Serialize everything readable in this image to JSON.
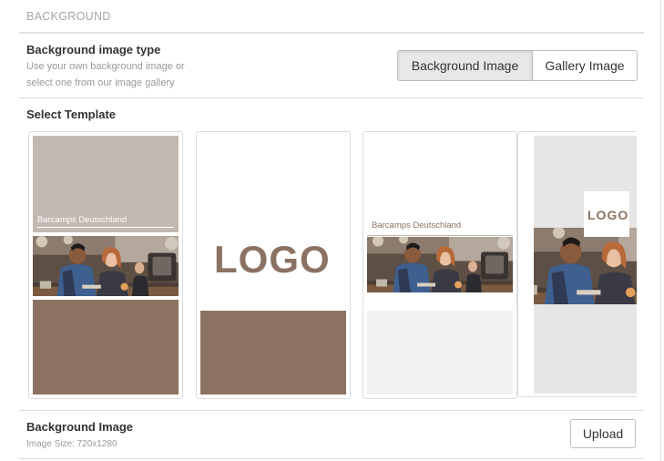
{
  "section": {
    "header": "BACKGROUND"
  },
  "image_type": {
    "label": "Background image type",
    "help": "Use your own background image or select one from our image gallery",
    "options": [
      "Background Image",
      "Gallery Image"
    ],
    "selected": "Background Image"
  },
  "templates": {
    "label": "Select Template",
    "items": [
      {
        "caption": "Barcamps Deutschland"
      },
      {
        "logo": "LOGO"
      },
      {
        "caption": "Barcamps Deutschland"
      },
      {
        "logo": "LOGO"
      }
    ]
  },
  "background_image": {
    "label": "Background Image",
    "help": "Image Size: 720x1280",
    "upload_label": "Upload"
  },
  "colors": {
    "taupe_light": "#c4b8b2",
    "brown": "#8b7262",
    "gray_light": "#f2f2f2",
    "gray_mid": "#e6e6e6"
  }
}
